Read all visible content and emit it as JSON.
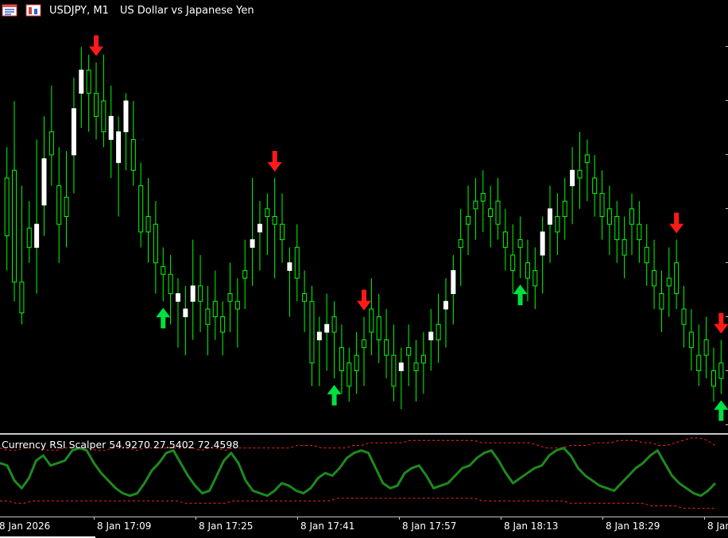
{
  "window": {
    "symbol_title": "USDJPY, M1",
    "description": "US Dollar vs Japanese Yen"
  },
  "colors": {
    "background": "#000000",
    "bull_candle": "#ffffff",
    "wick": "#00ff00",
    "buy_arrow": "#00e040",
    "sell_arrow": "#ff1a1a",
    "rsi_line": "#1e8a1e",
    "band_line": "#ff2020"
  },
  "icons": [
    "chart-window-icon",
    "trade-panel-icon"
  ],
  "indicator": {
    "label": "Currency RSI Scalper 54.9270 27.5402 72.4598",
    "name": "Currency RSI Scalper",
    "values": [
      54.927,
      27.5402,
      72.4598
    ]
  },
  "time_axis": {
    "labels": [
      "8 Jan 2026",
      "8 Jan 17:09",
      "8 Jan 17:25",
      "8 Jan 17:41",
      "8 Jan 17:57",
      "8 Jan 18:13",
      "8 Jan 18:29",
      "8 Jan 18:"
    ]
  },
  "chart_data": {
    "type": "candlestick",
    "note_on_units": "Prices are relative chart levels (0 = bottom, 100 = top of visible range); no price scale values are printed.",
    "candles": [
      [
        60,
        68,
        36,
        45
      ],
      [
        62,
        80,
        28,
        33
      ],
      [
        33,
        58,
        22,
        25
      ],
      [
        47,
        54,
        38,
        42
      ],
      [
        42,
        70,
        30,
        48
      ],
      [
        53,
        76,
        45,
        65
      ],
      [
        72,
        84,
        58,
        66
      ],
      [
        58,
        68,
        38,
        48
      ],
      [
        55,
        67,
        42,
        50
      ],
      [
        66,
        86,
        56,
        78
      ],
      [
        82,
        94,
        73,
        88
      ],
      [
        88,
        92,
        72,
        82
      ],
      [
        82,
        90,
        70,
        76
      ],
      [
        80,
        92,
        68,
        72
      ],
      [
        70,
        84,
        60,
        76
      ],
      [
        64,
        76,
        50,
        72
      ],
      [
        72,
        82,
        62,
        80
      ],
      [
        70,
        80,
        58,
        62
      ],
      [
        58,
        64,
        42,
        46
      ],
      [
        50,
        60,
        38,
        46
      ],
      [
        48,
        54,
        30,
        38
      ],
      [
        37,
        42,
        28,
        35
      ],
      [
        35,
        40,
        22,
        30
      ],
      [
        28,
        34,
        16,
        30
      ],
      [
        24,
        32,
        14,
        26
      ],
      [
        28,
        44,
        18,
        32
      ],
      [
        32,
        40,
        20,
        28
      ],
      [
        26,
        32,
        14,
        22
      ],
      [
        28,
        36,
        18,
        24
      ],
      [
        24,
        28,
        14,
        20
      ],
      [
        30,
        38,
        20,
        28
      ],
      [
        28,
        34,
        16,
        26
      ],
      [
        36,
        44,
        26,
        34
      ],
      [
        42,
        60,
        32,
        44
      ],
      [
        46,
        54,
        36,
        48
      ],
      [
        52,
        56,
        40,
        50
      ],
      [
        50,
        60,
        34,
        48
      ],
      [
        48,
        56,
        38,
        44
      ],
      [
        36,
        42,
        24,
        38
      ],
      [
        42,
        48,
        28,
        34
      ],
      [
        30,
        36,
        20,
        28
      ],
      [
        28,
        32,
        6,
        12
      ],
      [
        18,
        24,
        6,
        20
      ],
      [
        20,
        30,
        10,
        22
      ],
      [
        24,
        28,
        8,
        20
      ],
      [
        16,
        22,
        4,
        10
      ],
      [
        12,
        16,
        2,
        6
      ],
      [
        14,
        20,
        4,
        10
      ],
      [
        18,
        24,
        6,
        16
      ],
      [
        26,
        34,
        14,
        20
      ],
      [
        24,
        30,
        12,
        18
      ],
      [
        18,
        26,
        8,
        14
      ],
      [
        14,
        22,
        2,
        6
      ],
      [
        10,
        16,
        0,
        12
      ],
      [
        16,
        22,
        6,
        14
      ],
      [
        12,
        18,
        2,
        10
      ],
      [
        14,
        20,
        4,
        12
      ],
      [
        18,
        26,
        10,
        20
      ],
      [
        22,
        30,
        12,
        18
      ],
      [
        26,
        34,
        16,
        28
      ],
      [
        30,
        40,
        22,
        36
      ],
      [
        44,
        52,
        32,
        42
      ],
      [
        50,
        58,
        40,
        48
      ],
      [
        54,
        60,
        44,
        52
      ],
      [
        56,
        62,
        46,
        54
      ],
      [
        52,
        58,
        42,
        50
      ],
      [
        54,
        60,
        44,
        48
      ],
      [
        46,
        52,
        36,
        42
      ],
      [
        40,
        48,
        30,
        36
      ],
      [
        44,
        50,
        34,
        42
      ],
      [
        38,
        44,
        28,
        34
      ],
      [
        36,
        42,
        26,
        32
      ],
      [
        40,
        50,
        30,
        46
      ],
      [
        48,
        58,
        38,
        52
      ],
      [
        50,
        56,
        40,
        46
      ],
      [
        54,
        60,
        44,
        50
      ],
      [
        58,
        68,
        48,
        62
      ],
      [
        62,
        72,
        52,
        60
      ],
      [
        66,
        70,
        54,
        64
      ],
      [
        60,
        66,
        50,
        56
      ],
      [
        56,
        62,
        44,
        50
      ],
      [
        52,
        58,
        40,
        48
      ],
      [
        50,
        54,
        38,
        44
      ],
      [
        44,
        50,
        34,
        40
      ],
      [
        52,
        56,
        40,
        48
      ],
      [
        48,
        54,
        38,
        44
      ],
      [
        42,
        48,
        32,
        38
      ],
      [
        36,
        44,
        26,
        32
      ],
      [
        30,
        36,
        20,
        26
      ],
      [
        34,
        42,
        24,
        32
      ],
      [
        38,
        44,
        26,
        30
      ],
      [
        26,
        32,
        16,
        22
      ],
      [
        20,
        26,
        10,
        16
      ],
      [
        14,
        22,
        6,
        10
      ],
      [
        18,
        24,
        8,
        14
      ],
      [
        10,
        16,
        2,
        6
      ],
      [
        12,
        18,
        4,
        8
      ]
    ],
    "signals": [
      {
        "type": "sell",
        "bar": 12
      },
      {
        "type": "buy",
        "bar": 21
      },
      {
        "type": "sell",
        "bar": 36
      },
      {
        "type": "buy",
        "bar": 44
      },
      {
        "type": "sell",
        "bar": 48
      },
      {
        "type": "buy",
        "bar": 69
      },
      {
        "type": "sell",
        "bar": 90
      },
      {
        "type": "sell",
        "bar": 102
      },
      {
        "type": "buy",
        "bar": 124
      }
    ],
    "rsi": [
      60,
      58,
      46,
      40,
      48,
      62,
      66,
      58,
      60,
      62,
      70,
      72,
      70,
      60,
      52,
      46,
      40,
      36,
      34,
      36,
      44,
      54,
      60,
      68,
      70,
      60,
      50,
      42,
      36,
      38,
      50,
      62,
      68,
      60,
      46,
      38,
      36,
      34,
      38,
      44,
      42,
      38,
      36,
      40,
      48,
      52,
      50,
      56,
      64,
      68,
      70,
      68,
      56,
      44,
      40,
      42,
      52,
      56,
      58,
      50,
      40,
      42,
      44,
      50,
      56,
      58,
      64,
      68,
      70,
      62,
      52,
      44,
      48,
      52,
      56,
      58,
      66,
      70,
      72,
      66,
      56,
      50,
      46,
      42,
      40,
      38,
      44,
      50,
      56,
      60,
      66,
      70,
      60,
      50,
      44,
      40,
      36,
      34,
      38,
      44
    ],
    "upper_band": [
      72,
      70,
      70,
      72,
      72,
      72,
      70,
      70,
      72,
      72,
      72,
      72,
      70,
      70,
      72,
      72,
      72,
      70,
      72,
      72,
      72,
      72,
      72,
      72,
      72,
      70,
      72,
      72,
      70,
      72,
      72,
      72,
      72,
      72,
      72,
      72,
      72,
      74,
      74,
      74,
      72,
      72,
      72,
      72,
      74,
      74,
      76,
      76,
      76,
      76,
      76,
      78,
      78,
      78,
      78,
      78,
      78,
      78,
      78,
      78,
      76,
      76,
      76,
      76,
      76,
      76,
      76,
      74,
      72,
      72,
      72,
      74,
      74,
      74,
      76,
      76,
      76,
      78,
      78,
      78,
      76,
      76,
      74,
      74,
      76,
      78,
      80,
      80,
      78,
      74
    ],
    "lower_band": [
      30,
      30,
      28,
      28,
      30,
      30,
      30,
      30,
      30,
      30,
      30,
      30,
      30,
      30,
      30,
      30,
      30,
      30,
      30,
      30,
      30,
      30,
      30,
      28,
      28,
      28,
      28,
      28,
      28,
      30,
      30,
      30,
      30,
      30,
      30,
      30,
      30,
      30,
      30,
      30,
      30,
      30,
      32,
      32,
      32,
      32,
      32,
      32,
      32,
      32,
      32,
      32,
      32,
      32,
      32,
      32,
      32,
      32,
      32,
      32,
      30,
      30,
      30,
      30,
      30,
      30,
      30,
      30,
      30,
      30,
      30,
      28,
      28,
      28,
      28,
      28,
      28,
      28,
      28,
      28,
      28,
      26,
      26,
      26,
      26,
      24,
      24,
      24,
      24,
      24
    ],
    "rsi_range": [
      20,
      80
    ]
  }
}
